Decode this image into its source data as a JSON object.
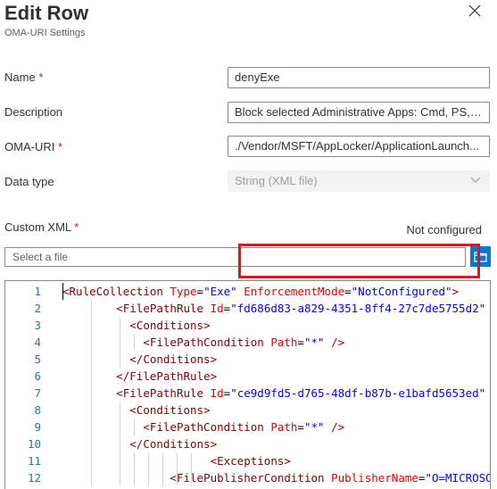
{
  "dialog": {
    "title": "Edit Row",
    "subtitle": "OMA-URI Settings"
  },
  "form": {
    "name": {
      "label": "Name",
      "required": "*",
      "value": "denyExe"
    },
    "description": {
      "label": "Description",
      "value": "Block selected Administrative Apps: Cmd, PS, ..."
    },
    "oma_uri": {
      "label": "OMA-URI",
      "required": "*",
      "value": "./Vendor/MSFT/AppLocker/ApplicationLaunch..."
    },
    "data_type": {
      "label": "Data type",
      "value": "String (XML file)"
    },
    "custom_xml": {
      "label": "Custom XML",
      "required": "*",
      "status": "Not configured"
    },
    "file": {
      "placeholder": "Select a file"
    }
  },
  "editor": {
    "lines": [
      {
        "n": "1",
        "tokens": [
          [
            "pun",
            "<"
          ],
          [
            "tag",
            "RuleCollection"
          ],
          [
            "txt",
            " "
          ],
          [
            "attr",
            "Type"
          ],
          [
            "txt",
            "="
          ],
          [
            "val",
            "\"Exe\""
          ],
          [
            "txt",
            " "
          ],
          [
            "attr",
            "EnforcementMode"
          ],
          [
            "txt",
            "="
          ],
          [
            "val",
            "\"NotConfigured\""
          ],
          [
            "pun",
            ">"
          ]
        ]
      },
      {
        "n": "2",
        "tokens": [
          [
            "txt",
            "        "
          ],
          [
            "pun",
            "<"
          ],
          [
            "tag",
            "FilePathRule"
          ],
          [
            "txt",
            " "
          ],
          [
            "attr",
            "Id"
          ],
          [
            "txt",
            "="
          ],
          [
            "val",
            "\"fd686d83-a829-4351-8ff4-27c7de5755d2\""
          ]
        ]
      },
      {
        "n": "3",
        "tokens": [
          [
            "txt",
            "          "
          ],
          [
            "pun",
            "<"
          ],
          [
            "tag",
            "Conditions"
          ],
          [
            "pun",
            ">"
          ]
        ]
      },
      {
        "n": "4",
        "tokens": [
          [
            "txt",
            "            "
          ],
          [
            "pun",
            "<"
          ],
          [
            "tag",
            "FilePathCondition"
          ],
          [
            "txt",
            " "
          ],
          [
            "attr",
            "Path"
          ],
          [
            "txt",
            "="
          ],
          [
            "val",
            "\"*\""
          ],
          [
            "txt",
            " "
          ],
          [
            "pun",
            "/>"
          ]
        ]
      },
      {
        "n": "5",
        "tokens": [
          [
            "txt",
            "          "
          ],
          [
            "pun",
            "</"
          ],
          [
            "tag",
            "Conditions"
          ],
          [
            "pun",
            ">"
          ]
        ]
      },
      {
        "n": "6",
        "tokens": [
          [
            "txt",
            "        "
          ],
          [
            "pun",
            "</"
          ],
          [
            "tag",
            "FilePathRule"
          ],
          [
            "pun",
            ">"
          ]
        ]
      },
      {
        "n": "7",
        "tokens": [
          [
            "txt",
            "        "
          ],
          [
            "pun",
            "<"
          ],
          [
            "tag",
            "FilePathRule"
          ],
          [
            "txt",
            " "
          ],
          [
            "attr",
            "Id"
          ],
          [
            "txt",
            "="
          ],
          [
            "val",
            "\"ce9d9fd5-d765-48df-b87b-e1bafd5653ed\""
          ]
        ]
      },
      {
        "n": "8",
        "tokens": [
          [
            "txt",
            "          "
          ],
          [
            "pun",
            "<"
          ],
          [
            "tag",
            "Conditions"
          ],
          [
            "pun",
            ">"
          ]
        ]
      },
      {
        "n": "9",
        "tokens": [
          [
            "txt",
            "            "
          ],
          [
            "pun",
            "<"
          ],
          [
            "tag",
            "FilePathCondition"
          ],
          [
            "txt",
            " "
          ],
          [
            "attr",
            "Path"
          ],
          [
            "txt",
            "="
          ],
          [
            "val",
            "\"*\""
          ],
          [
            "txt",
            " "
          ],
          [
            "pun",
            "/>"
          ]
        ]
      },
      {
        "n": "10",
        "tokens": [
          [
            "txt",
            "          "
          ],
          [
            "pun",
            "</"
          ],
          [
            "tag",
            "Conditions"
          ],
          [
            "pun",
            ">"
          ]
        ]
      },
      {
        "n": "11",
        "tokens": [
          [
            "txt",
            "                      "
          ],
          [
            "pun",
            "<"
          ],
          [
            "tag",
            "Exceptions"
          ],
          [
            "pun",
            ">"
          ]
        ]
      },
      {
        "n": "12",
        "tokens": [
          [
            "txt",
            "                "
          ],
          [
            "pun",
            "<"
          ],
          [
            "tag",
            "FilePublisherCondition"
          ],
          [
            "txt",
            " "
          ],
          [
            "attr",
            "PublisherName"
          ],
          [
            "txt",
            "="
          ],
          [
            "val",
            "\"O=MICROSOFT"
          ]
        ]
      }
    ]
  },
  "colors": {
    "accent": "#0078d4",
    "highlight_box": "#e3141a",
    "required": "#a4262c"
  }
}
